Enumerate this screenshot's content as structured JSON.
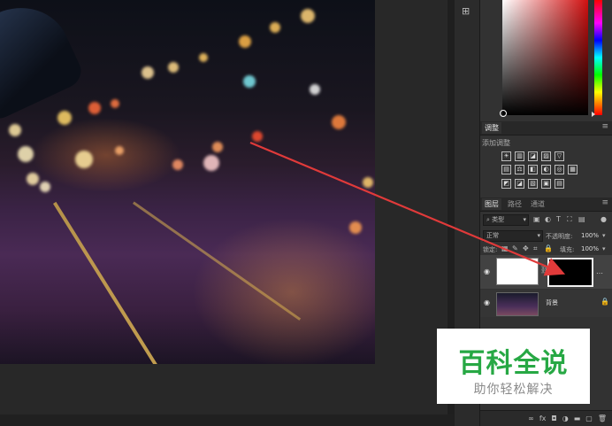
{
  "canvas": {
    "photo_desc_alt": ""
  },
  "panels": {
    "adjustments_tab": "调整",
    "add_adjustment": "添加调整",
    "layers_tabs": [
      "图层",
      "路径",
      "通道"
    ],
    "kind_select": "类型",
    "blend_mode": "正常",
    "opacity_label": "不透明度:",
    "opacity_value": "100%",
    "lock_label": "锁定:",
    "fill_label": "填充:",
    "fill_value": "100%",
    "layers": [
      {
        "name": "",
        "type": "mask-layer"
      },
      {
        "name": "背景",
        "type": "background"
      }
    ]
  },
  "watermark": {
    "title": "百科全说",
    "subtitle": "助你轻松解决"
  },
  "colors": {
    "watermark_green": "#27a844",
    "arrow_red": "#e03a3a"
  },
  "icons": {
    "adjust_row1": [
      "☀",
      "▥",
      "◪",
      "▨",
      "▽"
    ],
    "adjust_row2": [
      "▤",
      "⚖",
      "◧",
      "◐",
      "◎",
      "▦"
    ],
    "adjust_row3": [
      "◩",
      "◪",
      "▧",
      "▣",
      "▤"
    ],
    "footer": [
      "∞",
      "fx",
      "◘",
      "◑",
      "▬",
      "▢",
      "🗑"
    ]
  }
}
